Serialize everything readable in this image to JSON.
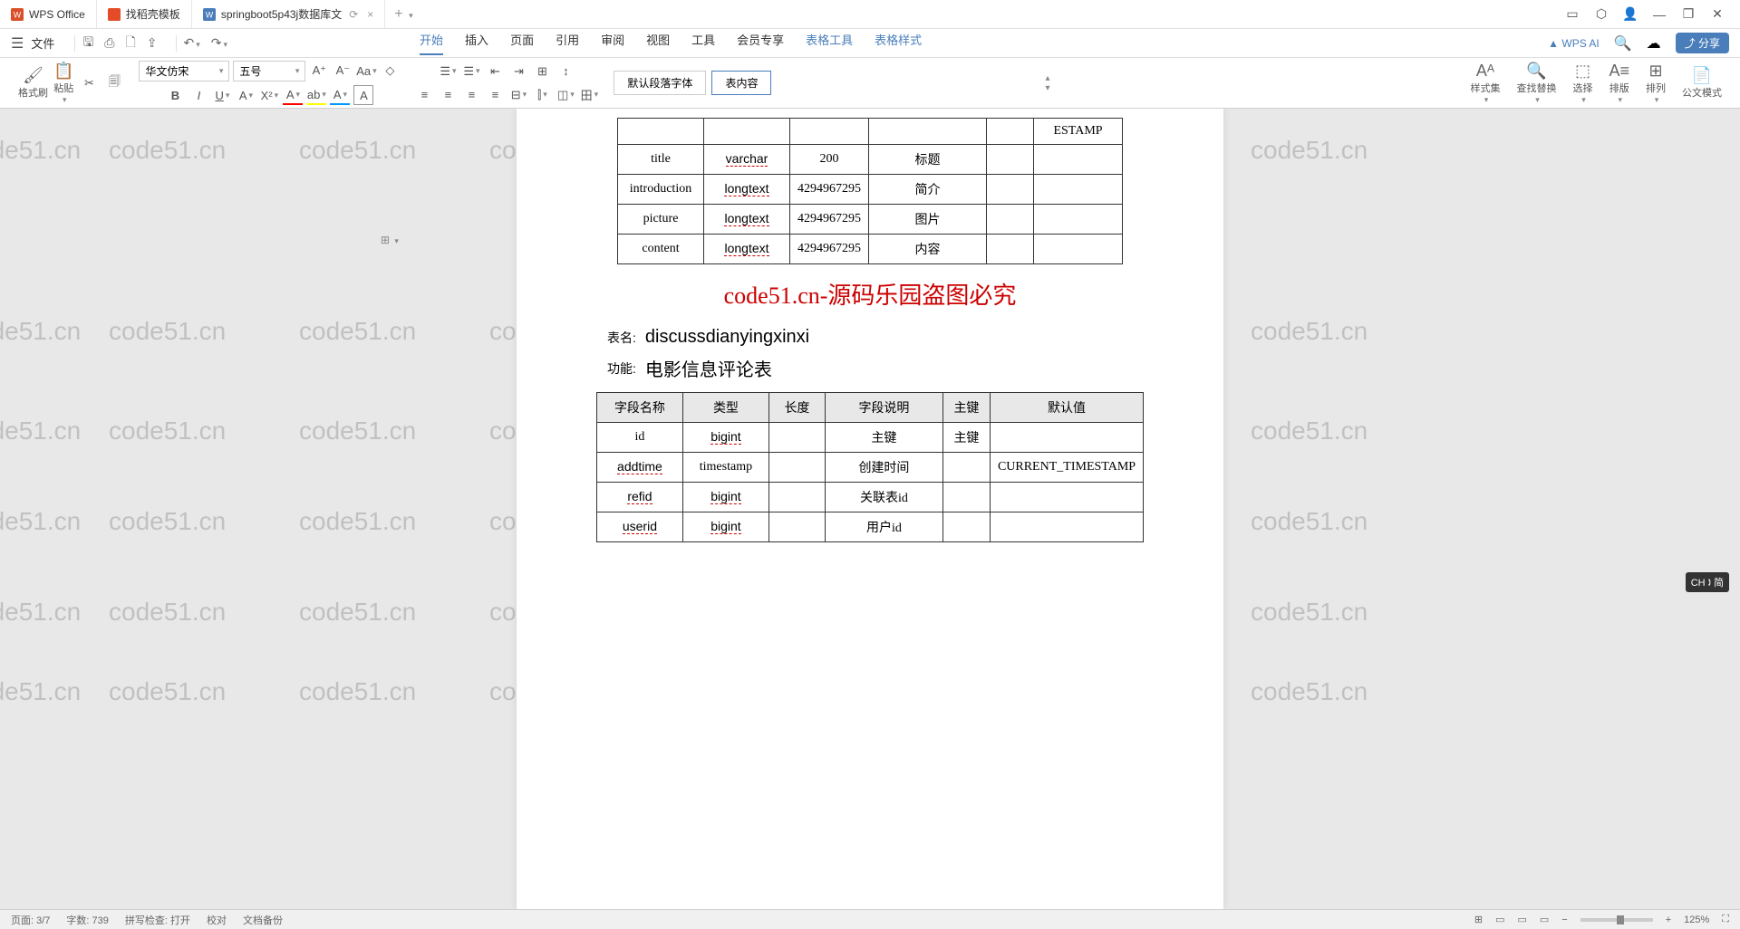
{
  "titlebar": {
    "app": "WPS Office",
    "tab2": "找稻壳模板",
    "tab3": "springboot5p43j数据库文",
    "tab_add": "+"
  },
  "quickbar": {
    "file": "文件",
    "menu_tabs": [
      "开始",
      "插入",
      "页面",
      "引用",
      "审阅",
      "视图",
      "工具",
      "会员专享"
    ],
    "table_tools": "表格工具",
    "table_style": "表格样式",
    "wps_ai": "WPS AI",
    "share": "分享"
  },
  "ribbon": {
    "format_brush": "格式刷",
    "paste": "粘贴",
    "font_name": "华文仿宋",
    "font_size": "五号",
    "style_default": "默认段落字体",
    "style_content": "表内容",
    "style_set": "样式集",
    "find_replace": "查找替换",
    "select": "选择",
    "layout": "排版",
    "arrange": "排列",
    "official": "公文模式"
  },
  "doc": {
    "page_marker": "⊞",
    "table1": {
      "rows": [
        {
          "c1": "",
          "c2": "",
          "c3": "",
          "c4": "",
          "c5": "",
          "c6": "ESTAMP"
        },
        {
          "c1": "title",
          "c2": "varchar",
          "c3": "200",
          "c4": "标题",
          "c5": "",
          "c6": ""
        },
        {
          "c1": "introduction",
          "c2": "longtext",
          "c3": "4294967295",
          "c4": "简介",
          "c5": "",
          "c6": ""
        },
        {
          "c1": "picture",
          "c2": "longtext",
          "c3": "4294967295",
          "c4": "图片",
          "c5": "",
          "c6": ""
        },
        {
          "c1": "content",
          "c2": "longtext",
          "c3": "4294967295",
          "c4": "内容",
          "c5": "",
          "c6": ""
        }
      ]
    },
    "red_banner": "code51.cn-源码乐园盗图必究",
    "table_name_label": "表名:",
    "table_name_value": "discussdianyingxinxi",
    "function_label": "功能:",
    "function_value": "电影信息评论表",
    "table2": {
      "headers": [
        "字段名称",
        "类型",
        "长度",
        "字段说明",
        "主键",
        "默认值"
      ],
      "rows": [
        {
          "c1": "id",
          "c2": "bigint",
          "c3": "",
          "c4": "主键",
          "c5": "主键",
          "c6": ""
        },
        {
          "c1": "addtime",
          "c2": "timestamp",
          "c3": "",
          "c4": "创建时间",
          "c5": "",
          "c6": "CURRENT_TIMESTAMP"
        },
        {
          "c1": "refid",
          "c2": "bigint",
          "c3": "",
          "c4": "关联表id",
          "c5": "",
          "c6": ""
        },
        {
          "c1": "userid",
          "c2": "bigint",
          "c3": "",
          "c4": "用户id",
          "c5": "",
          "c6": ""
        }
      ]
    }
  },
  "watermark": "code51.cn",
  "statusbar": {
    "page": "页面: 3/7",
    "words": "字数: 739",
    "spell": "拼写检查: 打开",
    "proofread": "校对",
    "backup": "文档备份",
    "zoom": "125%"
  },
  "ime": "CH 🕽 简"
}
